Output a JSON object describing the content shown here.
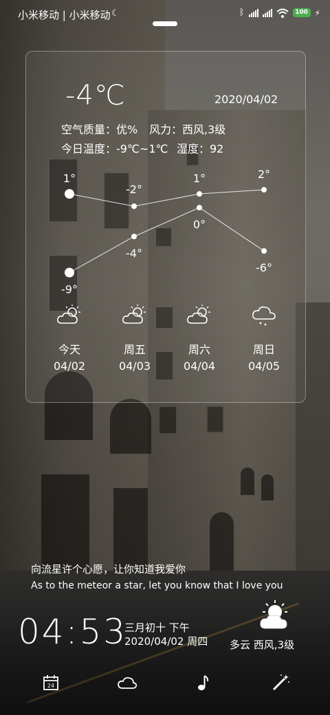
{
  "status_bar": {
    "carrier": "小米移动 | 小米移动",
    "battery": "100",
    "icons": [
      "bluetooth-icon",
      "signal-icon",
      "signal-icon",
      "wifi-icon",
      "battery-icon",
      "charging-icon"
    ]
  },
  "weather": {
    "current_temp": "-4℃",
    "date": "2020/04/02",
    "air_quality": "空气质量：优%",
    "wind": "风力：西风,3级",
    "temp_range": "今日温度：-9℃~1℃",
    "humidity": "湿度：92"
  },
  "chart_data": {
    "type": "line",
    "categories": [
      "今天",
      "周五",
      "周六",
      "周日"
    ],
    "series": [
      {
        "values": [
          1,
          -2,
          1,
          2
        ]
      },
      {
        "values": [
          -9,
          -4,
          0,
          -6
        ]
      }
    ],
    "high_labels": [
      "1°",
      "-2°",
      "1°",
      "2°"
    ],
    "low_labels": [
      "-9°",
      "-4°",
      "0°",
      "-6°"
    ]
  },
  "forecast": [
    {
      "day": "今天",
      "date": "04/02",
      "icon": "partly-cloudy-icon"
    },
    {
      "day": "周五",
      "date": "04/03",
      "icon": "partly-cloudy-icon"
    },
    {
      "day": "周六",
      "date": "04/04",
      "icon": "partly-cloudy-icon"
    },
    {
      "day": "周日",
      "date": "04/05",
      "icon": "cloud-rain-icon"
    }
  ],
  "quote": {
    "cn": "向流星许个心愿，让你知道我爱你",
    "en": "As to the meteor a star, let you know that I love you"
  },
  "clock": {
    "time": "04:53",
    "lunar": "三月初十  下午",
    "date": "2020/04/02  周四",
    "weather": "多云  西风,3级"
  },
  "dock": {
    "calendar_day": "24",
    "items": [
      "calendar-icon",
      "cloud-icon",
      "music-icon",
      "magic-wand-icon"
    ]
  },
  "colors": {
    "battery": "#4caf50",
    "text": "#ffffff"
  }
}
